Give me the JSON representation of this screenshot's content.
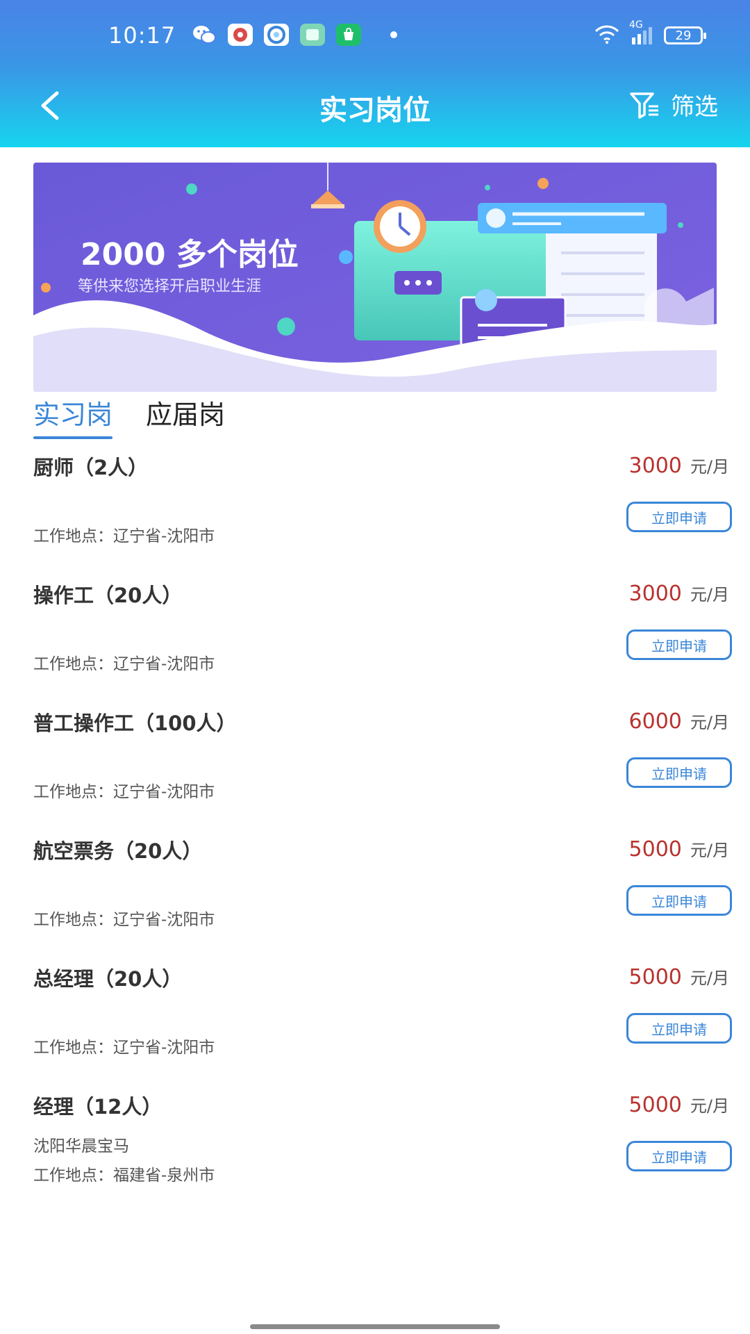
{
  "status_bar": {
    "time": "10:17",
    "network": "4G",
    "battery": "29",
    "icons": [
      "wechat-icon",
      "app-icon",
      "browser-icon",
      "tablet-icon",
      "shop-icon",
      "notification-dot-icon",
      "wifi-icon",
      "signal-icon",
      "battery-icon"
    ]
  },
  "nav": {
    "title": "实习岗位",
    "filter_label": "筛选"
  },
  "banner": {
    "headline": "2000 多个岗位",
    "subline": "等供来您选择开启职业生涯"
  },
  "tabs": [
    {
      "label": "实习岗",
      "active": true
    },
    {
      "label": "应届岗",
      "active": false
    }
  ],
  "jobs": [
    {
      "title": "厨师（2人）",
      "salary": "3000",
      "unit": "元/月",
      "company": "",
      "location": "工作地点：辽宁省-沈阳市",
      "apply": "立即申请"
    },
    {
      "title": "操作工（20人）",
      "salary": "3000",
      "unit": "元/月",
      "company": "",
      "location": "工作地点：辽宁省-沈阳市",
      "apply": "立即申请"
    },
    {
      "title": "普工操作工（100人）",
      "salary": "6000",
      "unit": "元/月",
      "company": "",
      "location": "工作地点：辽宁省-沈阳市",
      "apply": "立即申请"
    },
    {
      "title": "航空票务（20人）",
      "salary": "5000",
      "unit": "元/月",
      "company": "",
      "location": "工作地点：辽宁省-沈阳市",
      "apply": "立即申请"
    },
    {
      "title": "总经理（20人）",
      "salary": "5000",
      "unit": "元/月",
      "company": "",
      "location": "工作地点：辽宁省-沈阳市",
      "apply": "立即申请"
    },
    {
      "title": "经理（12人）",
      "salary": "5000",
      "unit": "元/月",
      "company": "沈阳华晨宝马",
      "location": "工作地点：福建省-泉州市",
      "apply": "立即申请"
    }
  ],
  "colors": {
    "header_top": "#4a83e6",
    "header_bottom": "#16d4ee",
    "accent": "#3a86d8",
    "salary": "#b8322f",
    "banner_bg": "#6f5ad6"
  }
}
